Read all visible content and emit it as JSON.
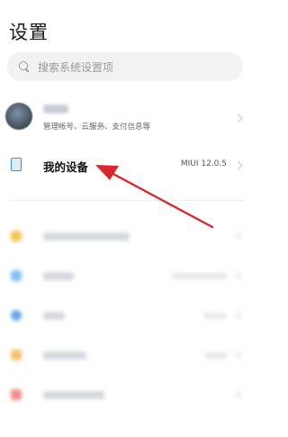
{
  "page": {
    "title": "设置"
  },
  "search": {
    "placeholder": "搜索系统设置项",
    "icon": "search-icon"
  },
  "account": {
    "subtitle": "管理帐号、云服务、支付信息等"
  },
  "device": {
    "label": "我的设备",
    "version": "MIUI 12.0.5",
    "icon": "phone-icon"
  },
  "colors": {
    "accent_blue": "#3d8fe0",
    "annotation_red": "#d9262a",
    "blur_icon_colors": [
      "#f6c453",
      "#7cc3f5",
      "#63a8f0",
      "#f7c169",
      "#f28b8b"
    ]
  }
}
